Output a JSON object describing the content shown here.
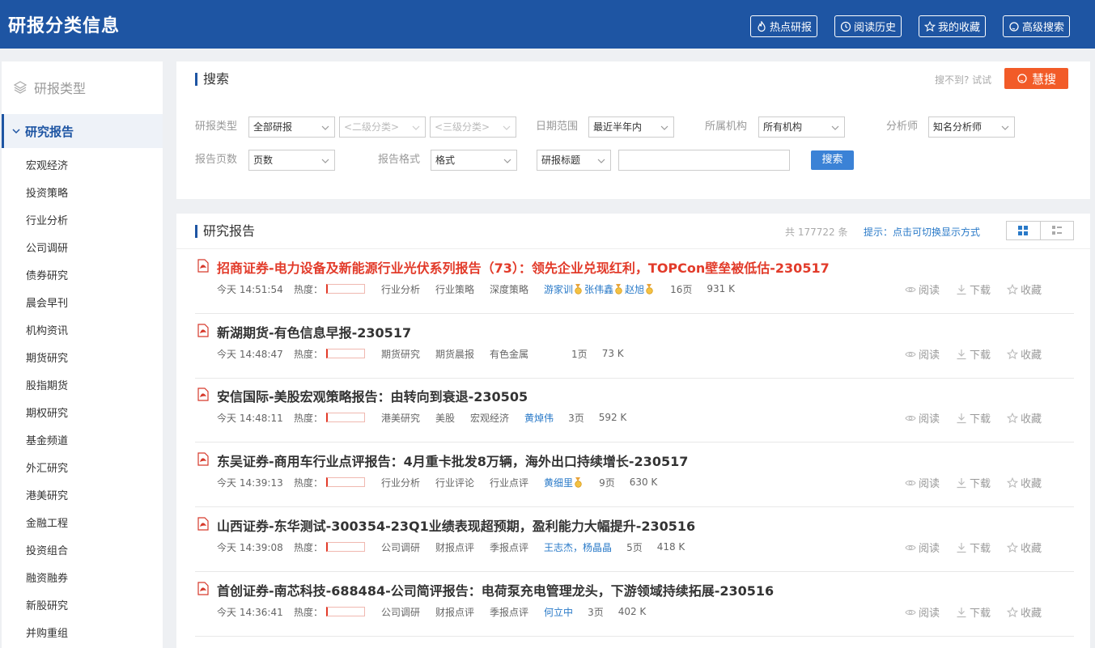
{
  "header": {
    "title": "研报分类信息",
    "buttons": [
      "热点研报",
      "阅读历史",
      "我的收藏",
      "高级搜索"
    ]
  },
  "sidebar": {
    "heading": "研报类型",
    "active": "研究报告",
    "items": [
      "宏观经济",
      "投资策略",
      "行业分析",
      "公司调研",
      "债券研究",
      "晨会早刊",
      "机构资讯",
      "期货研究",
      "股指期货",
      "期权研究",
      "基金频道",
      "外汇研究",
      "港美研究",
      "金融工程",
      "投资组合",
      "融资融券",
      "新股研究",
      "并购重组"
    ]
  },
  "search": {
    "title": "搜索",
    "hint": "搜不到? 试试",
    "huisou": "慧搜",
    "labels": {
      "type": "研报类型",
      "date": "日期范围",
      "org": "所属机构",
      "analyst": "分析师",
      "pages": "报告页数",
      "format": "报告格式"
    },
    "selects": {
      "type": "全部研报",
      "sub2": "<二级分类>",
      "sub3": "<三级分类>",
      "date": "最近半年内",
      "org": "所有机构",
      "analyst": "知名分析师",
      "pages": "页数",
      "format": "格式",
      "field": "研报标题"
    },
    "keyword_value": "",
    "button": "搜索"
  },
  "list": {
    "title": "研究报告",
    "count": "共 177722 条",
    "toggle_hint": "提示：点击可切换显示方式",
    "heat_label": "热度：",
    "actions": [
      "阅读",
      "下载",
      "收藏"
    ],
    "reports": [
      {
        "title": "招商证券-电力设备及新能源行业光伏系列报告（73）：领先企业兑现红利，TOPCon壁垒被低估-230517",
        "hot": true,
        "time": "今天 14:51:54",
        "tags": [
          "行业分析",
          "行业策略",
          "深度策略"
        ],
        "authors": [
          "游家训",
          "张伟鑫",
          "赵旭"
        ],
        "medals": true,
        "pages": "16页",
        "size": "931 K"
      },
      {
        "title": "新湖期货-有色信息早报-230517",
        "hot": false,
        "time": "今天 14:48:47",
        "tags": [
          "期货研究",
          "期货晨报",
          "有色金属"
        ],
        "authors": [],
        "medals": false,
        "pages": "1页",
        "size": "73 K"
      },
      {
        "title": "安信国际-美股宏观策略报告：由转向到衰退-230505",
        "hot": false,
        "time": "今天 14:48:11",
        "tags": [
          "港美研究",
          "美股",
          "宏观经济"
        ],
        "authors": [
          "黄焯伟"
        ],
        "medals": false,
        "pages": "3页",
        "size": "592 K"
      },
      {
        "title": "东吴证券-商用车行业点评报告：4月重卡批发8万辆，海外出口持续增长-230517",
        "hot": false,
        "time": "今天 14:39:13",
        "tags": [
          "行业分析",
          "行业评论",
          "行业点评"
        ],
        "authors": [
          "黄细里"
        ],
        "medals": true,
        "pages": "9页",
        "size": "630 K"
      },
      {
        "title": "山西证券-东华测试-300354-23Q1业绩表现超预期，盈利能力大幅提升-230516",
        "hot": false,
        "time": "今天 14:39:08",
        "tags": [
          "公司调研",
          "财报点评",
          "季报点评"
        ],
        "authors": [
          "王志杰，杨晶晶"
        ],
        "medals": false,
        "pages": "5页",
        "size": "418 K"
      },
      {
        "title": "首创证券-南芯科技-688484-公司简评报告：电荷泵充电管理龙头，下游领域持续拓展-230516",
        "hot": false,
        "time": "今天 14:36:41",
        "tags": [
          "公司调研",
          "财报点评",
          "季报点评"
        ],
        "authors": [
          "何立中"
        ],
        "medals": false,
        "pages": "3页",
        "size": "402 K"
      }
    ]
  },
  "colors": {
    "brand": "#1e55a3",
    "hot": "#e23b2a",
    "link": "#2a7ac8",
    "accent": "#f25b28"
  }
}
